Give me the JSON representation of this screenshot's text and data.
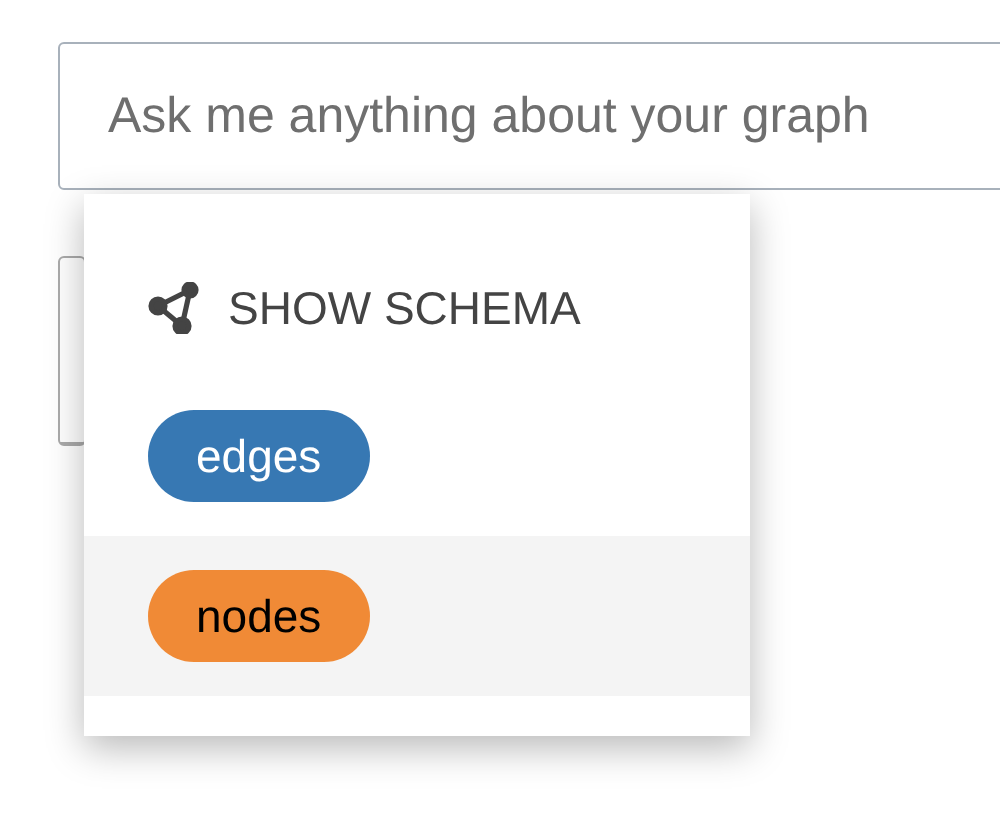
{
  "search": {
    "placeholder": "Ask me anything about your graph"
  },
  "menu": {
    "header": "SHOW SCHEMA",
    "items": [
      {
        "label": "edges",
        "color": "#3778b3",
        "selected": false
      },
      {
        "label": "nodes",
        "color": "#f08a36",
        "selected": true
      }
    ]
  }
}
